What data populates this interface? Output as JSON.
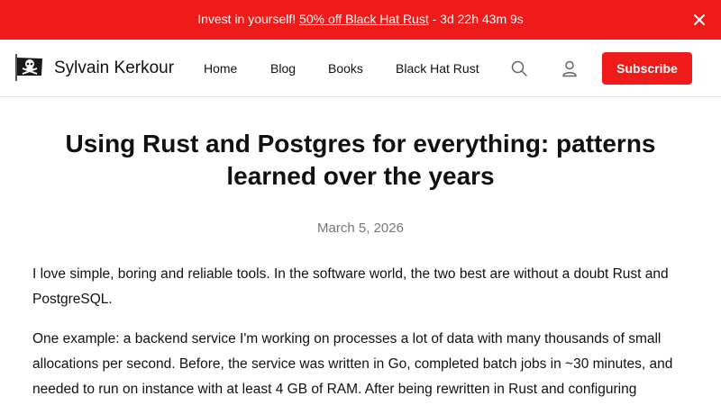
{
  "banner": {
    "prefix": "Invest in yourself!",
    "link_text": "50% off Black Hat Rust",
    "suffix": "- 3d 22h 43m 9s",
    "close_icon": "close-icon",
    "background": "#ef1a1a"
  },
  "nav": {
    "site_name": "Sylvain Kerkour",
    "logo_icon": "pirate-flag-icon",
    "links": [
      "Home",
      "Blog",
      "Books",
      "Black Hat Rust"
    ],
    "search_icon": "search-icon",
    "account_icon": "user-icon",
    "subscribe_label": "Subscribe",
    "accent": "#ef1a1a"
  },
  "article": {
    "title": "Using Rust and Postgres for everything: patterns learned over the years",
    "date": "March 5, 2026",
    "paragraphs": [
      "I love simple, boring and reliable tools. In the software world, the two best are without a doubt Rust and PostgreSQL.",
      "One example: a backend service I'm working on processes a lot of data with many thousands of small allocations per second. Before, the service was written in Go, completed batch jobs in ~30 minutes, and needed to run on instance with at least 4 GB of RAM. After being rewritten in Rust and configuring"
    ]
  }
}
